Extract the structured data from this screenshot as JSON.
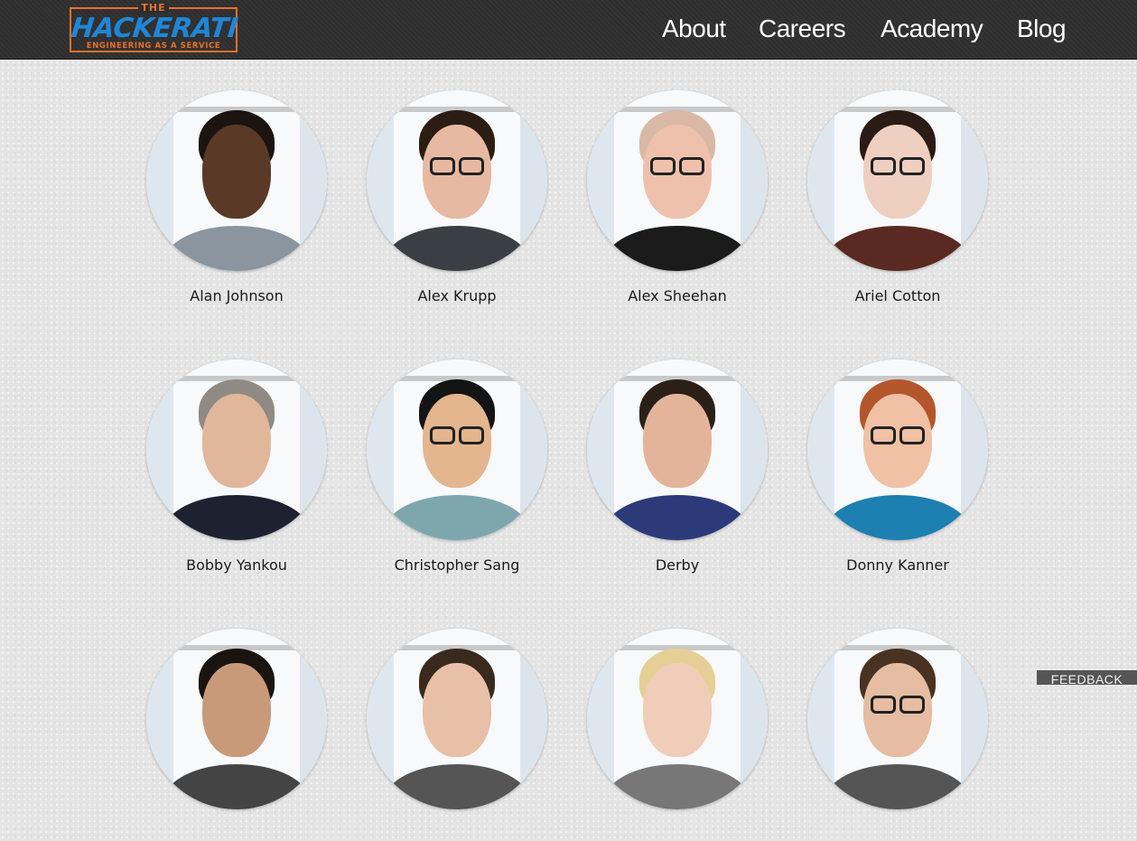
{
  "brand": {
    "logo_top": "THE",
    "logo_main": "HACKERATI",
    "logo_tagline": "ENGINEERING AS A SERVICE",
    "colors": {
      "logo_orange": "#e8702a",
      "logo_blue": "#1f86d6",
      "header_bg": "#2e2e2e",
      "page_bg": "#e4e4e4"
    }
  },
  "nav": {
    "items": [
      {
        "label": "About"
      },
      {
        "label": "Careers"
      },
      {
        "label": "Academy"
      },
      {
        "label": "Blog"
      }
    ]
  },
  "team": {
    "members": [
      {
        "name": "Alan Johnson",
        "skin": "#5a3a26",
        "hair": "#1c1410",
        "shirt": "#8a95a0",
        "glasses": false
      },
      {
        "name": "Alex Krupp",
        "skin": "#e7b9a2",
        "hair": "#2b1d14",
        "shirt": "#3a3f45",
        "glasses": true
      },
      {
        "name": "Alex Sheehan",
        "skin": "#efc1ad",
        "hair": "#d9b8a6",
        "shirt": "#1b1b1b",
        "glasses": true
      },
      {
        "name": "Ariel Cotton",
        "skin": "#efcfbf",
        "hair": "#2a1b14",
        "shirt": "#5a2a22",
        "glasses": true
      },
      {
        "name": "Bobby Yankou",
        "skin": "#e1b79b",
        "hair": "#8f8a83",
        "shirt": "#1e2230",
        "glasses": false
      },
      {
        "name": "Christopher Sang",
        "skin": "#e3b68f",
        "hair": "#141414",
        "shirt": "#7ea7ad",
        "glasses": true
      },
      {
        "name": "Derby",
        "skin": "#e4b49a",
        "hair": "#2a2018",
        "shirt": "#2d3a7a",
        "glasses": false
      },
      {
        "name": "Donny Kanner",
        "skin": "#f0c1a4",
        "hair": "#b3562c",
        "shirt": "#1e7fb1",
        "glasses": true
      },
      {
        "name": "",
        "skin": "#c89a7a",
        "hair": "#1a1410",
        "shirt": "#444",
        "glasses": false
      },
      {
        "name": "",
        "skin": "#e8c0a8",
        "hair": "#3a2a1e",
        "shirt": "#555",
        "glasses": false
      },
      {
        "name": "",
        "skin": "#f0cdb8",
        "hair": "#e6cf96",
        "shirt": "#777",
        "glasses": false
      },
      {
        "name": "",
        "skin": "#e6bca2",
        "hair": "#4a3222",
        "shirt": "#555",
        "glasses": true
      }
    ]
  },
  "feedback": {
    "label": "FEEDBACK"
  }
}
